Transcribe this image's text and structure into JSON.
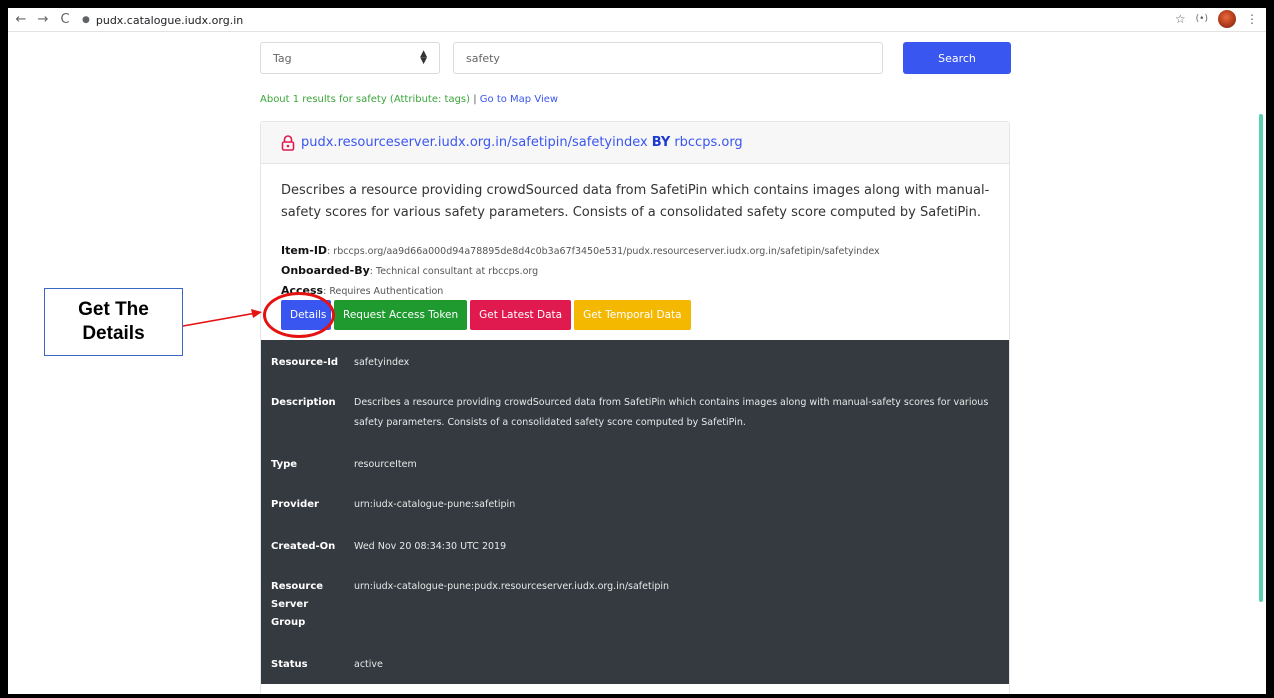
{
  "browser": {
    "url": "pudx.catalogue.iudx.org.in",
    "back_icon": "←",
    "forward_icon": "→",
    "reload_icon": "C",
    "star_icon": "☆",
    "ext_icon": "(•)",
    "menu_icon": "⋮"
  },
  "search": {
    "tag_value": "Tag",
    "query_value": "safety",
    "search_label": "Search"
  },
  "results": {
    "summary": "About 1 results for safety (Attribute: tags)",
    "separator": " | ",
    "map_link": "Go to Map View"
  },
  "card": {
    "resource_link": "pudx.resourceserver.iudx.org.in/safetipin/safetyindex",
    "by_label": "BY",
    "provider_link": "rbccps.org",
    "description": "Describes a resource providing crowdSourced data from SafetiPin which contains images along with manual-safety scores for various safety parameters. Consists of a consolidated safety score computed by SafetiPin.",
    "item_id_label": "Item-ID",
    "item_id_value": ": rbccps.org/aa9d66a000d94a78895de8d4c0b3a67f3450e531/pudx.resourceserver.iudx.org.in/safetipin/safetyindex",
    "onboarded_label": "Onboarded-By",
    "onboarded_value": ": Technical consultant at rbccps.org",
    "access_label": "Access",
    "access_value": ": Requires Authentication",
    "buttons": {
      "details": "Details",
      "token": "Request Access Token",
      "latest": "Get Latest Data",
      "temporal": "Get Temporal Data"
    },
    "colors": {
      "details": "#3a56f0",
      "token": "#1e9a2e",
      "latest": "#e01a4f",
      "temporal": "#f5b800",
      "table_bg": "#343a40"
    }
  },
  "details_table": [
    {
      "key": "Resource-Id",
      "value": "safetyindex"
    },
    {
      "key": "Description",
      "value": "Describes a resource providing crowdSourced data from SafetiPin which contains images along with manual-safety scores for various safety parameters. Consists of a consolidated safety score computed by SafetiPin."
    },
    {
      "key": "Type",
      "value": "resourceItem"
    },
    {
      "key": "Provider",
      "value": "urn:iudx-catalogue-pune:safetipin"
    },
    {
      "key": "Created-On",
      "value": "Wed Nov 20 08:34:30 UTC 2019"
    },
    {
      "key": "Resource Server Group",
      "value": "urn:iudx-catalogue-pune:pudx.resourceserver.iudx.org.in/safetipin"
    },
    {
      "key": "Status",
      "value": "active"
    }
  ],
  "annotation": {
    "line1": "Get The",
    "line2": "Details",
    "color": "#e51212"
  }
}
